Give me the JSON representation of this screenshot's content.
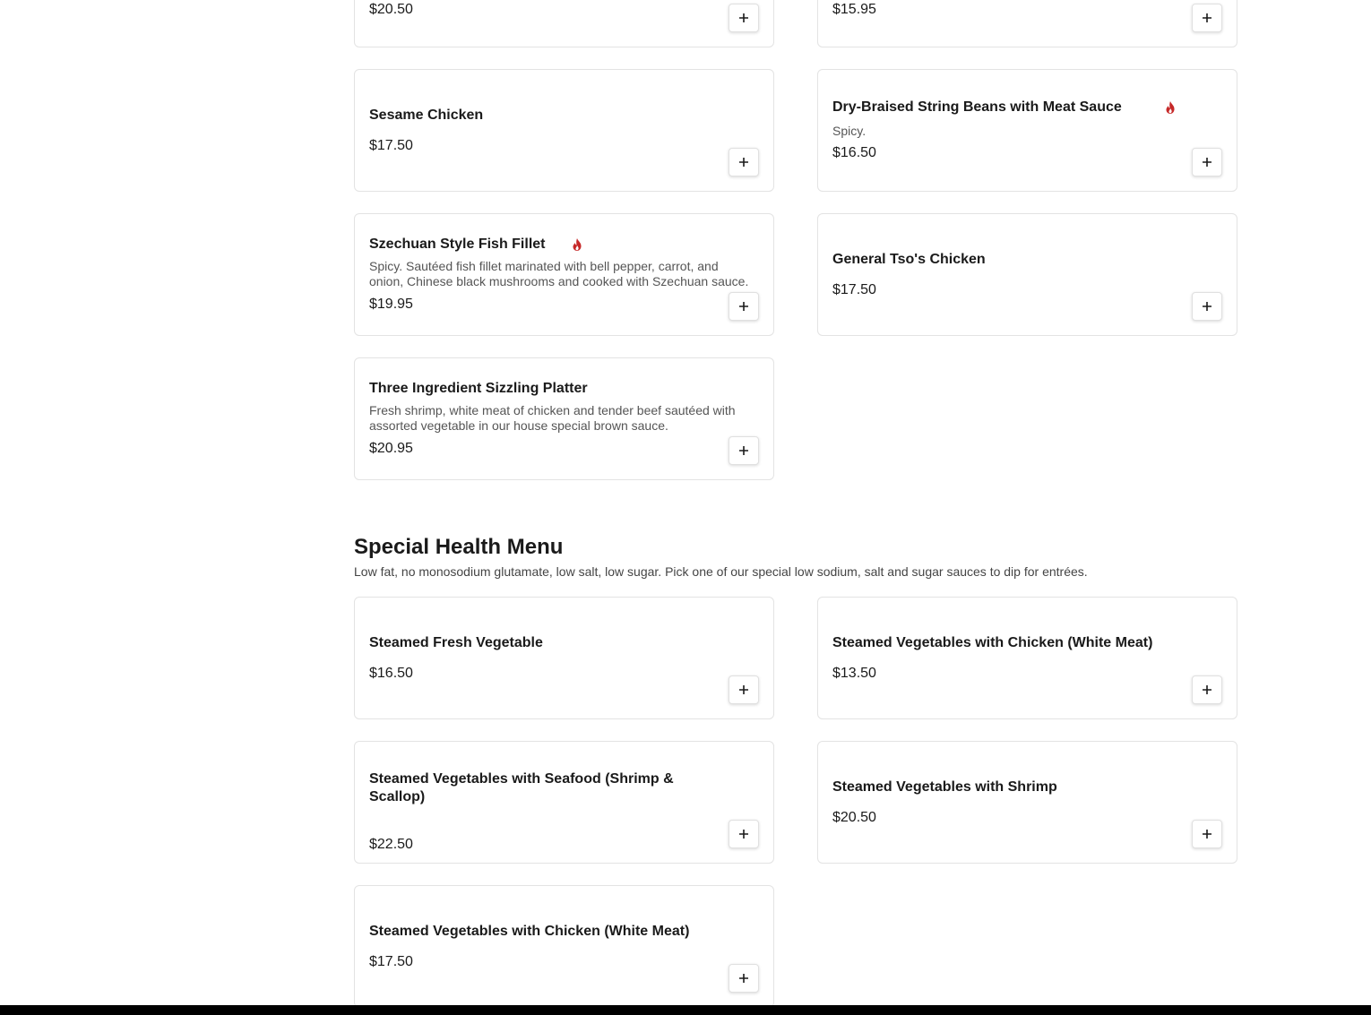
{
  "top_items": [
    {
      "price": "$20.50"
    },
    {
      "price": "$15.95"
    }
  ],
  "items": [
    {
      "name": "Sesame Chicken",
      "price": "$17.50",
      "description": "",
      "spicy": false
    },
    {
      "name": "Dry-Braised String Beans with Meat Sauce",
      "price": "$16.50",
      "description": "Spicy.",
      "spicy": true
    },
    {
      "name": "Szechuan Style Fish Fillet",
      "price": "$19.95",
      "description": "Spicy. Sautéed fish fillet marinated with bell pepper, carrot, and onion, Chinese black mushrooms and cooked with Szechuan sauce.",
      "spicy": true
    },
    {
      "name": "General Tso's Chicken",
      "price": "$17.50",
      "description": "",
      "spicy": false
    },
    {
      "name": "Three Ingredient Sizzling Platter",
      "price": "$20.95",
      "description": "Fresh shrimp, white meat of chicken and tender beef sautéed with assorted vegetable in our house special brown sauce.",
      "spicy": false
    }
  ],
  "health_section": {
    "title": "Special Health Menu",
    "description": "Low fat, no monosodium glutamate, low salt, low sugar. Pick one of our special low sodium, salt and sugar sauces to dip for entrées.",
    "items": [
      {
        "name": "Steamed Fresh Vegetable",
        "price": "$16.50"
      },
      {
        "name": "Steamed Vegetables with Chicken (White Meat)",
        "price": "$13.50"
      },
      {
        "name": "Steamed Vegetables with Seafood (Shrimp & Scallop)",
        "price": "$22.50"
      },
      {
        "name": "Steamed Vegetables with Shrimp",
        "price": "$20.50"
      },
      {
        "name": "Steamed Vegetables with Chicken (White Meat)",
        "price": "$17.50"
      }
    ]
  },
  "colors": {
    "spicy_icon": "#c62828",
    "card_border": "#e3e3e3",
    "text": "#1a1a1a"
  },
  "icons": {
    "add": "plus-icon",
    "spicy": "flame-icon"
  }
}
